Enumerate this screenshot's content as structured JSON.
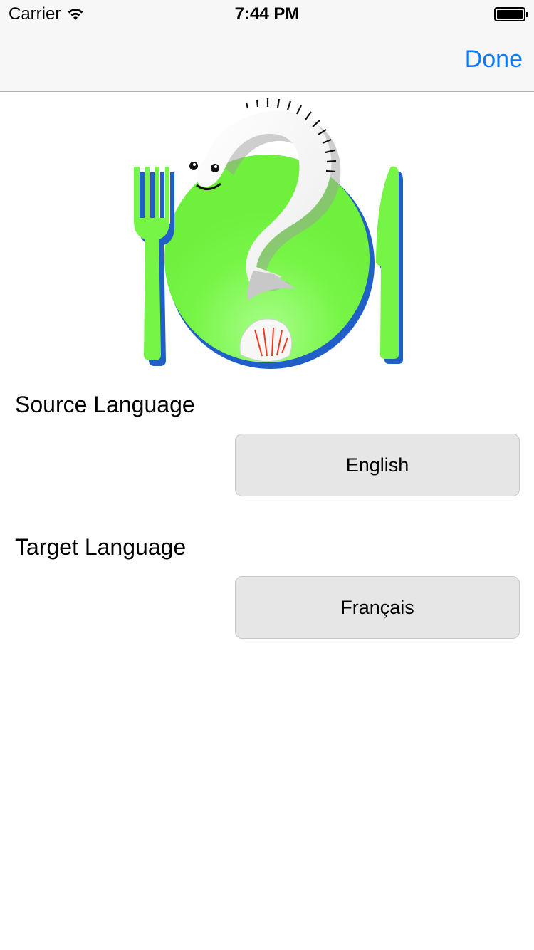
{
  "status_bar": {
    "carrier": "Carrier",
    "time": "7:44 PM",
    "wifi_icon": "wifi-icon",
    "battery_icon": "battery-full-icon"
  },
  "nav_bar": {
    "done_label": "Done",
    "accent_color": "#0a7aff"
  },
  "logo": {
    "icon": "fish-question-mark-plate-logo",
    "plate_color": "#77f547",
    "shadow_color": "#1f5fc7"
  },
  "source": {
    "label": "Source Language",
    "value": "English"
  },
  "target": {
    "label": "Target Language",
    "value": "Français"
  }
}
